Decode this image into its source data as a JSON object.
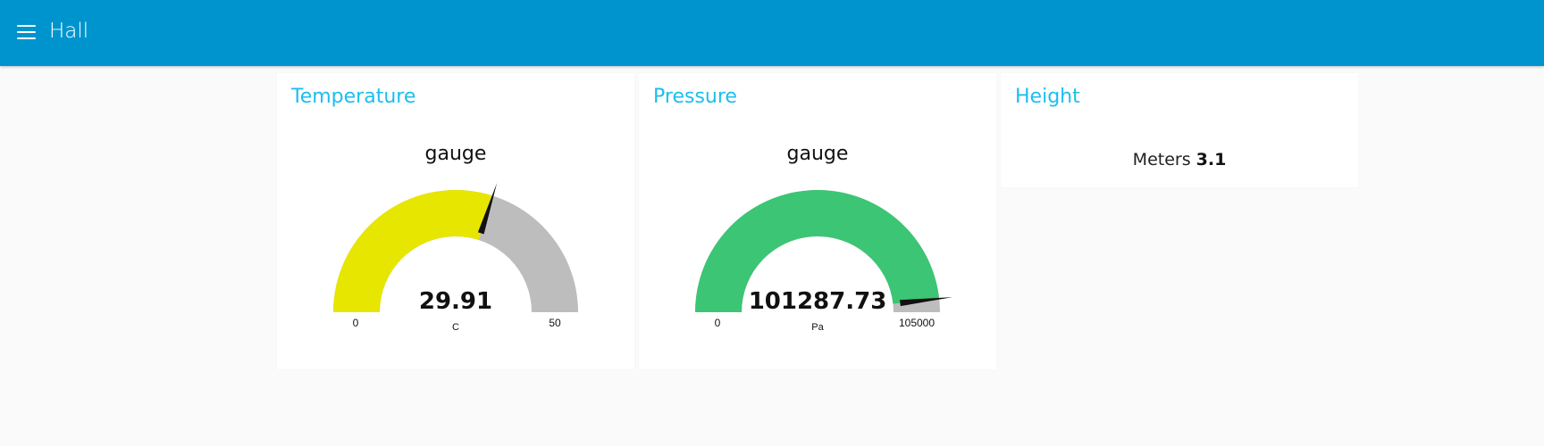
{
  "header": {
    "title": "Hall"
  },
  "cards": [
    {
      "title": "Temperature",
      "gauge": {
        "label": "gauge",
        "value": 29.91,
        "value_text": "29.91",
        "min": 0,
        "max": 50,
        "min_label": "0",
        "max_label": "50",
        "units": "C",
        "fill_color": "#e6e600",
        "track_color": "#bdbdbd"
      }
    },
    {
      "title": "Pressure",
      "gauge": {
        "label": "gauge",
        "value": 101287.73,
        "value_text": "101287.73",
        "min": 0,
        "max": 105000,
        "min_label": "0",
        "max_label": "105000",
        "units": "Pa",
        "fill_color": "#3cc574",
        "track_color": "#bdbdbd"
      }
    },
    {
      "title": "Height",
      "text": {
        "label": "Meters",
        "value": "3.1"
      }
    }
  ]
}
